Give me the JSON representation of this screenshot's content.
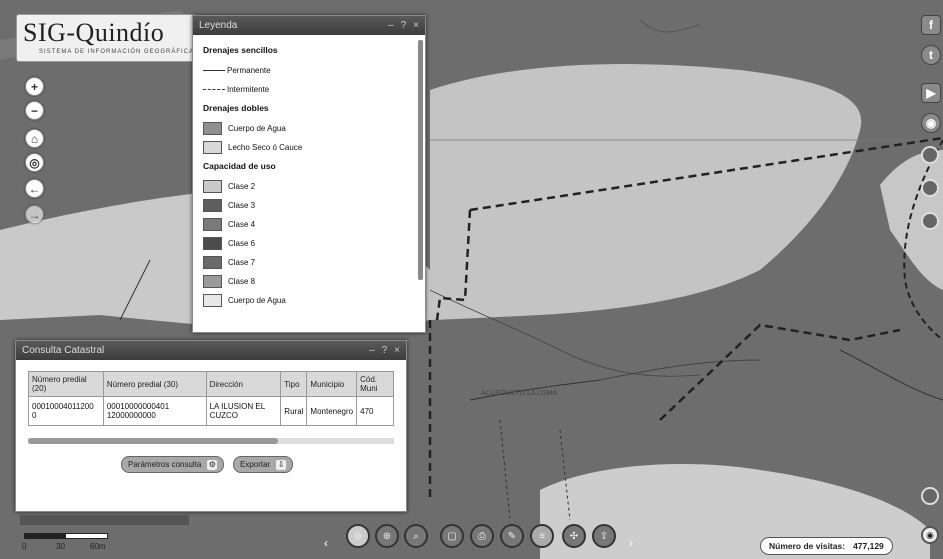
{
  "app": {
    "logo_title": "SIG-Quindío",
    "logo_subtitle": "SISTEMA DE INFORMACIÓN GEOGRÁFICA"
  },
  "map_controls": [
    {
      "name": "zoom-in-button",
      "icon": "+"
    },
    {
      "name": "zoom-out-button",
      "icon": "−"
    },
    {
      "name": "home-button",
      "icon": "⌂"
    },
    {
      "name": "locate-button",
      "icon": "◎"
    },
    {
      "name": "back-button",
      "icon": "←"
    },
    {
      "name": "forward-button",
      "icon": "→"
    }
  ],
  "legend": {
    "title": "Leyenda",
    "controls": [
      "–",
      "?",
      "×"
    ],
    "sections": [
      {
        "heading": "Drenajes sencillos",
        "items": [
          {
            "label": "Permanente",
            "type": "line"
          },
          {
            "label": "Intermitente",
            "type": "dash"
          }
        ]
      },
      {
        "heading": "Drenajes dobles",
        "items": [
          {
            "label": "Cuerpo de Agua",
            "type": "fill",
            "color": "#8f8f8f"
          },
          {
            "label": "Lecho Seco ó Cauce",
            "type": "fill",
            "color": "#d8d8d8"
          }
        ]
      },
      {
        "heading": "Capacidad de uso",
        "items": [
          {
            "label": "Clase 2",
            "type": "fill",
            "color": "#c9c9c9"
          },
          {
            "label": "Clase 3",
            "type": "fill",
            "color": "#5e5e5e"
          },
          {
            "label": "Clase 4",
            "type": "fill",
            "color": "#7a7a7a"
          },
          {
            "label": "Clase 6",
            "type": "fill",
            "color": "#4c4c4c"
          },
          {
            "label": "Clase 7",
            "type": "fill",
            "color": "#6a6a6a"
          },
          {
            "label": "Clase 8",
            "type": "fill",
            "color": "#9a9a9a"
          },
          {
            "label": "Cuerpo de Agua",
            "type": "fill",
            "color": "#e8e8e8"
          }
        ]
      }
    ]
  },
  "consulta": {
    "title": "Consulta Catastral",
    "controls": [
      "–",
      "?",
      "×"
    ],
    "columns": [
      "Número predial (20)",
      "Número predial (30)",
      "Dirección",
      "Tipo",
      "Municipio",
      "Cód. Muni"
    ],
    "rows": [
      [
        "00010004011200 0",
        "00010000000401 12000000000",
        "LA ILUSION EL CUZCO",
        "Rural",
        "Montenegro",
        "470"
      ]
    ],
    "btn_parametros": "Parámetros consulta",
    "btn_exportar": "Exportar"
  },
  "social": [
    {
      "name": "facebook-icon",
      "glyph": "f"
    },
    {
      "name": "twitter-icon",
      "glyph": "t"
    },
    {
      "name": "youtube-icon",
      "glyph": "▶"
    },
    {
      "name": "globe-icon",
      "glyph": "◉"
    }
  ],
  "visits": {
    "label": "Número de visitas:",
    "value": "477,129"
  },
  "scale": {
    "t0": "0",
    "t1": "30",
    "t2": "60m"
  },
  "map_label": "ACUEDUCTO LA LOMA"
}
